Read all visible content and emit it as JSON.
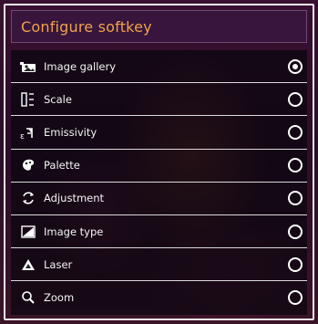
{
  "title": "Configure softkey",
  "items": [
    {
      "label": "Image gallery",
      "icon": "image-gallery-icon",
      "selected": true
    },
    {
      "label": "Scale",
      "icon": "scale-icon",
      "selected": false
    },
    {
      "label": "Emissivity",
      "icon": "emissivity-icon",
      "selected": false
    },
    {
      "label": "Palette",
      "icon": "palette-icon",
      "selected": false
    },
    {
      "label": "Adjustment",
      "icon": "adjustment-icon",
      "selected": false
    },
    {
      "label": "Image type",
      "icon": "image-type-icon",
      "selected": false
    },
    {
      "label": "Laser",
      "icon": "laser-icon",
      "selected": false
    },
    {
      "label": "Zoom",
      "icon": "zoom-icon",
      "selected": false
    }
  ],
  "colors": {
    "title_text": "#f0a34a",
    "accent_border": "#ffffff",
    "panel_bg": "#0a060e"
  }
}
